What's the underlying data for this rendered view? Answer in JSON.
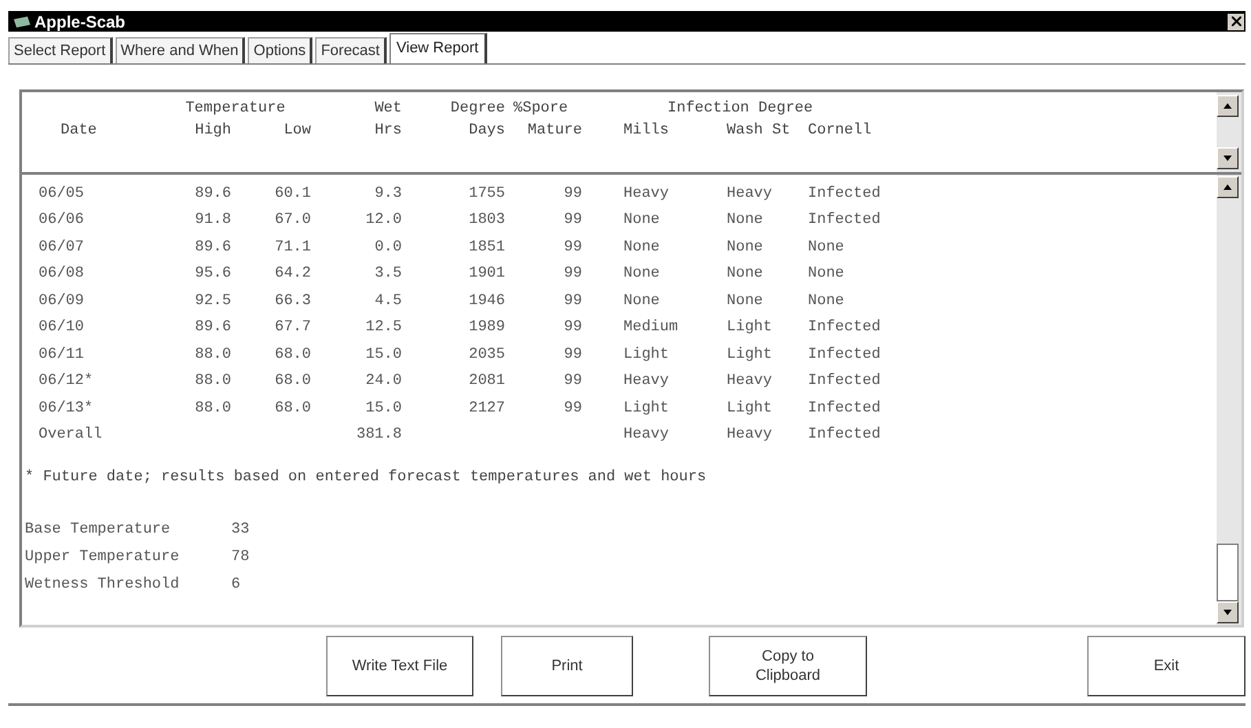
{
  "window": {
    "title": "Apple-Scab"
  },
  "tabs": [
    {
      "label": "Select Report",
      "selected": false
    },
    {
      "label": "Where and When",
      "selected": false
    },
    {
      "label": "Options",
      "selected": false
    },
    {
      "label": "Forecast",
      "selected": false
    },
    {
      "label": "View Report",
      "selected": true
    }
  ],
  "report": {
    "column_groups": [
      "Temperature",
      "Wet",
      "Degree",
      "%Spore",
      "Infection Degree"
    ],
    "columns": [
      "Date",
      "High",
      "Low",
      "Hrs",
      "Days",
      "Mature",
      "Mills",
      "Wash St",
      "Cornell"
    ],
    "rows": [
      {
        "date": "06/05",
        "high": "89.6",
        "low": "60.1",
        "wet_hrs": "9.3",
        "degree_days": "1755",
        "spore_mature": "99",
        "mills": "Heavy",
        "wash_st": "Heavy",
        "cornell": "Infected"
      },
      {
        "date": "06/06",
        "high": "91.8",
        "low": "67.0",
        "wet_hrs": "12.0",
        "degree_days": "1803",
        "spore_mature": "99",
        "mills": "None",
        "wash_st": "None",
        "cornell": "Infected"
      },
      {
        "date": "06/07",
        "high": "89.6",
        "low": "71.1",
        "wet_hrs": "0.0",
        "degree_days": "1851",
        "spore_mature": "99",
        "mills": "None",
        "wash_st": "None",
        "cornell": "None"
      },
      {
        "date": "06/08",
        "high": "95.6",
        "low": "64.2",
        "wet_hrs": "3.5",
        "degree_days": "1901",
        "spore_mature": "99",
        "mills": "None",
        "wash_st": "None",
        "cornell": "None"
      },
      {
        "date": "06/09",
        "high": "92.5",
        "low": "66.3",
        "wet_hrs": "4.5",
        "degree_days": "1946",
        "spore_mature": "99",
        "mills": "None",
        "wash_st": "None",
        "cornell": "None"
      },
      {
        "date": "06/10",
        "high": "89.6",
        "low": "67.7",
        "wet_hrs": "12.5",
        "degree_days": "1989",
        "spore_mature": "99",
        "mills": "Medium",
        "wash_st": "Light",
        "cornell": "Infected"
      },
      {
        "date": "06/11",
        "high": "88.0",
        "low": "68.0",
        "wet_hrs": "15.0",
        "degree_days": "2035",
        "spore_mature": "99",
        "mills": "Light",
        "wash_st": "Light",
        "cornell": "Infected"
      },
      {
        "date": "06/12*",
        "high": "88.0",
        "low": "68.0",
        "wet_hrs": "24.0",
        "degree_days": "2081",
        "spore_mature": "99",
        "mills": "Heavy",
        "wash_st": "Heavy",
        "cornell": "Infected"
      },
      {
        "date": "06/13*",
        "high": "88.0",
        "low": "68.0",
        "wet_hrs": "15.0",
        "degree_days": "2127",
        "spore_mature": "99",
        "mills": "Light",
        "wash_st": "Light",
        "cornell": "Infected"
      },
      {
        "date": "Overall",
        "wet_hrs": "381.8",
        "mills": "Heavy",
        "wash_st": "Heavy",
        "cornell": "Infected"
      }
    ],
    "footnote": "* Future date; results based on entered forecast temperatures and wet hours",
    "parameters": [
      {
        "label": "Base Temperature",
        "value": "33"
      },
      {
        "label": "Upper Temperature",
        "value": "78"
      },
      {
        "label": "Wetness Threshold",
        "value": "6"
      }
    ]
  },
  "buttons": [
    "Write Text File",
    "Print",
    "Copy to\nClipboard",
    "Exit"
  ]
}
